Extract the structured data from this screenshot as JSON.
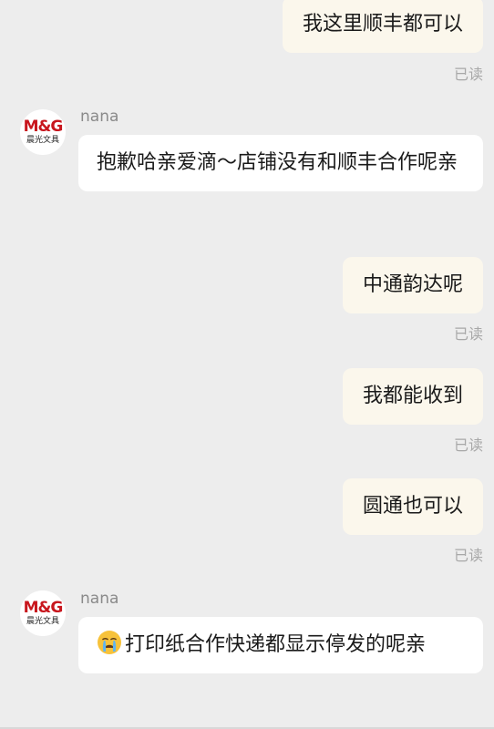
{
  "messages": [
    {
      "id": 0,
      "side": "self",
      "text": "我这里顺丰都可以",
      "status": "已读"
    },
    {
      "id": 1,
      "side": "other",
      "sender": "nana",
      "avatar": {
        "brand": "M&G",
        "brand_sub": "晨光文具"
      },
      "text": "抱歉哈亲爱滴～店铺没有和顺丰合作呢亲"
    },
    {
      "id": 2,
      "side": "self",
      "text": "中通韵达呢",
      "status": "已读"
    },
    {
      "id": 3,
      "side": "self",
      "text": "我都能收到",
      "status": "已读"
    },
    {
      "id": 4,
      "side": "self",
      "text": "圆通也可以",
      "status": "已读"
    },
    {
      "id": 5,
      "side": "other",
      "sender": "nana",
      "avatar": {
        "brand": "M&G",
        "brand_sub": "晨光文具"
      },
      "emoji": "crying-face-icon",
      "text": "打印纸合作快递都显示停发的呢亲"
    }
  ],
  "colors": {
    "background": "#ededed",
    "self_bubble": "#fbf7ec",
    "other_bubble": "#ffffff",
    "brand_red": "#c8161d",
    "read_label": "#a8a8a8"
  }
}
